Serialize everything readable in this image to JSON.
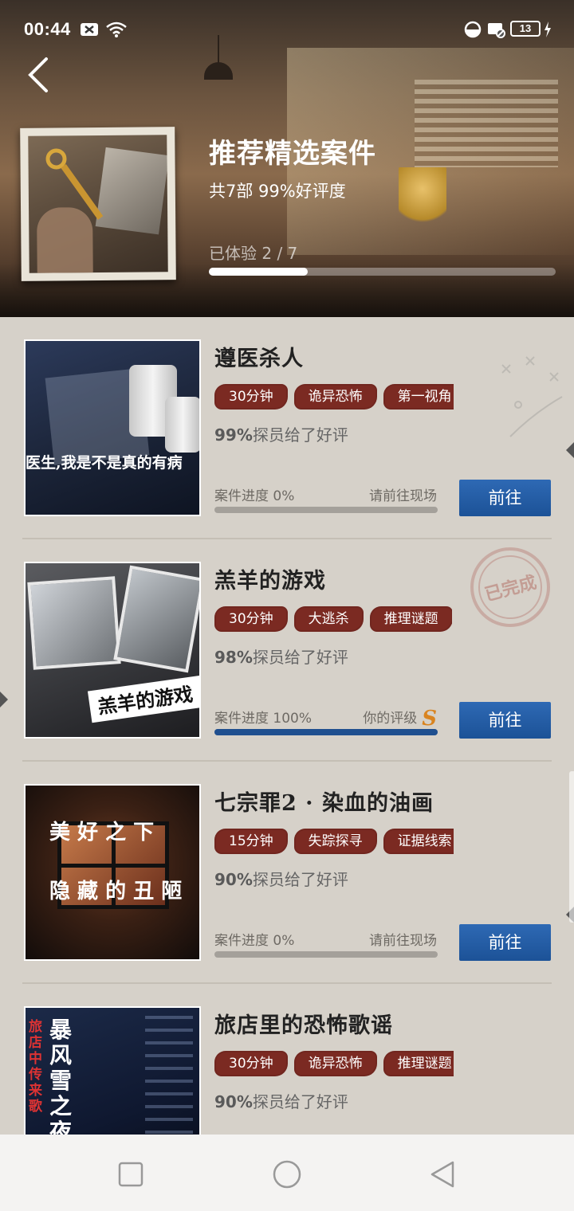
{
  "status_bar": {
    "time": "00:44",
    "battery": "13"
  },
  "header": {
    "title": "推荐精选案件",
    "subtitle": "共7部   99%好评度",
    "progress_text": "已体验 2 / 7",
    "progress_fraction": 0.286
  },
  "cases": [
    {
      "title": "遵医杀人",
      "tags": [
        "30分钟",
        "诡异恐怖",
        "第一视角"
      ],
      "rating_pct": "99%",
      "rating_text": "探员给了好评",
      "progress_label": "案件进度  0%",
      "progress_right": "请前往现场",
      "progress_fraction": 0,
      "button": "前往",
      "thumb_caption": "医生,我是不是真的有病"
    },
    {
      "title": "羔羊的游戏",
      "tags": [
        "30分钟",
        "大逃杀",
        "推理谜题"
      ],
      "rating_pct": "98%",
      "rating_text": "探员给了好评",
      "progress_label": "案件进度  100%",
      "progress_right": "你的评级",
      "grade": "S",
      "progress_fraction": 1,
      "button": "前往",
      "stamp": "已完成",
      "thumb_caption": "羔羊的游戏"
    },
    {
      "title": "七宗罪2 · 染血的油画",
      "tags": [
        "15分钟",
        "失踪探寻",
        "证据线索"
      ],
      "rating_pct": "90%",
      "rating_text": "探员给了好评",
      "progress_label": "案件进度  0%",
      "progress_right": "请前往现场",
      "progress_fraction": 0,
      "button": "前往",
      "thumb_caption_top": "美 好 之 下",
      "thumb_caption_bottom": "隐 藏 的 丑 陋"
    },
    {
      "title": "旅店里的恐怖歌谣",
      "tags": [
        "30分钟",
        "诡异恐怖",
        "推理谜题"
      ],
      "rating_pct": "90%",
      "rating_text": "探员给了好评",
      "thumb_caption": "暴风雪之夜",
      "thumb_caption_side": "旅店中传来歌"
    }
  ],
  "colors": {
    "tag_bg": "#7b2a22",
    "button_bg": "#1c5297",
    "progress_fill": "#1f4f8f",
    "list_bg": "#d6d1c9",
    "grade": "#d98420"
  }
}
